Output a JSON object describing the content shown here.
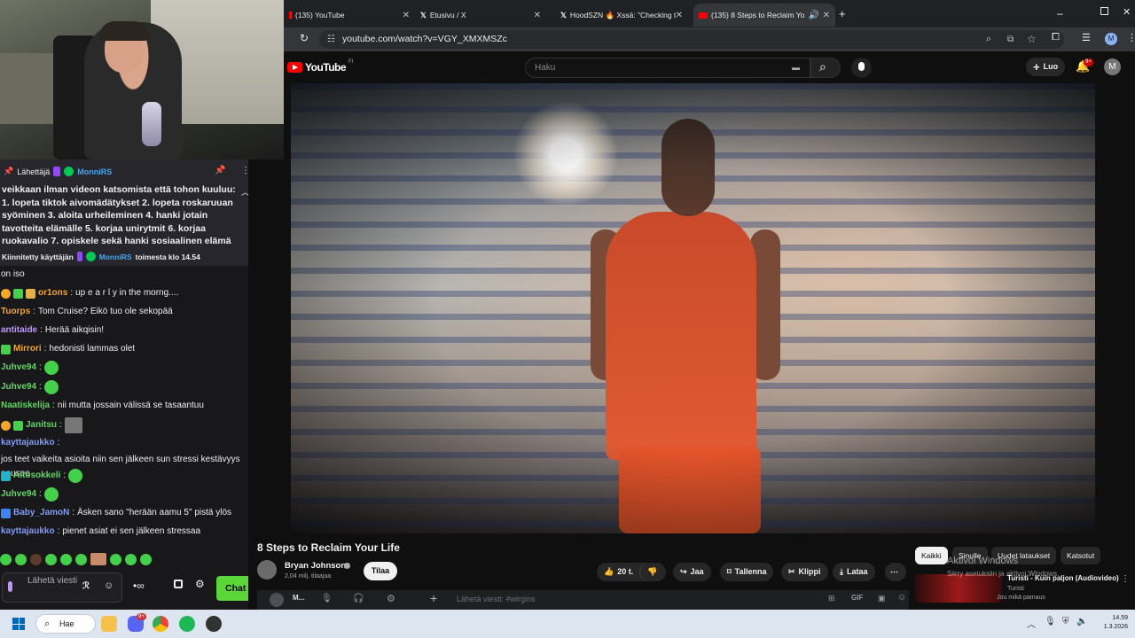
{
  "browser": {
    "tabs": [
      {
        "label": "(135) YouTube"
      },
      {
        "label": "Etusivu / X"
      },
      {
        "label": "HoodSZN 🔥 Xssä: \"Checking t"
      },
      {
        "label": "(135) 8 Steps to Reclaim Yo"
      }
    ],
    "url": "youtube.com/watch?v=VGY_XMXMSZc",
    "profile_initial": "M"
  },
  "youtube": {
    "logo": "YouTube",
    "logo_region": "FI",
    "search_placeholder": "Haku",
    "create_label": "Luo",
    "notifications_badge": "9+",
    "avatar_initial": "M",
    "video_title": "8 Steps to Reclaim Your Life",
    "channel_name": "Bryan Johnson",
    "subscribers": "2,04 milj. tilaajaa",
    "subscribe_label": "Tilaa",
    "like_count": "20 t.",
    "share_label": "Jaa",
    "save_label": "Tallenna",
    "clip_label": "Klippi",
    "download_label": "Lataa",
    "chips": [
      "Kaikki",
      "Sinulle",
      "Uudet lataukset",
      "Katsotut"
    ],
    "related_title": "Turisti - Kuin paljon (Audiovideo)",
    "related_channel": "Turisti",
    "related_meta": "Jou mikä pamaus"
  },
  "windows_activation": {
    "title": "Aktivoi Windows",
    "subtitle": "Siirry asetuksiin ja aktivoi Windows."
  },
  "chat": {
    "pinned_header_label": "Lähettäjä",
    "pinned_user": "MonniRS",
    "pinned_text": "veikkaan ilman videon katsomista että tohon kuuluu: 1. lopeta tiktok aivomädätykset 2. lopeta roskaruuan syöminen 3. aloita urheileminen 4. hanki jotain tavotteita elämälle 5. korjaa unirytmit 6. korjaa ruokavalio 7. opiskele sekä hanki sosiaalinen elämä",
    "pinned_footer_prefix": "Kiinnitetty käyttäjän",
    "pinned_footer_user": "MonniRS",
    "pinned_footer_suffix": "toimesta klo 14.54",
    "messages": [
      {
        "user": "",
        "text": "on iso"
      },
      {
        "user": "or1ons",
        "text": "up e a r l y in the morng...."
      },
      {
        "user": "Tuorps",
        "text": "Tom Cruise? Eikö tuo ole sekopää"
      },
      {
        "user": "antitaide",
        "text": "Herää aikqisin!"
      },
      {
        "user": "Mirrori",
        "text": "hedonisti lammas olet"
      },
      {
        "user": "Juhve94",
        "text": ""
      },
      {
        "user": "Juhve94",
        "text": ""
      },
      {
        "user": "Naatiskelija",
        "text": "nii mutta jossain välissä se tasaantuu"
      },
      {
        "user": "Janitsu",
        "text": ""
      },
      {
        "user": "kayttajaukko",
        "text": "jos teet vaikeita asioita niin sen jälkeen sun stressi kestävyys nousee"
      },
      {
        "user": "Aitosokkeli",
        "text": ""
      },
      {
        "user": "Juhve94",
        "text": ""
      },
      {
        "user": "Baby_JamoN",
        "text": "Äsken sano \"herään aamu 5\" pistä ylös"
      },
      {
        "user": "kayttajaukko",
        "text": "pienet asiat ei sen jälkeen stressaa"
      }
    ],
    "input_placeholder": "Lähetä viesti",
    "chat_button": "Chat"
  },
  "discord": {
    "user_short": "M...",
    "input_placeholder": "Lähetä viesti: #wirgins"
  },
  "taskbar": {
    "search_label": "Hae",
    "time": "14.59",
    "date": "1.3.2026",
    "discord_badge": "9+"
  },
  "colors": {
    "youtube_red": "#ff0000",
    "twitch_bg": "#18181b",
    "twitch_green": "#5bd639",
    "purple": "#bf94ff"
  }
}
